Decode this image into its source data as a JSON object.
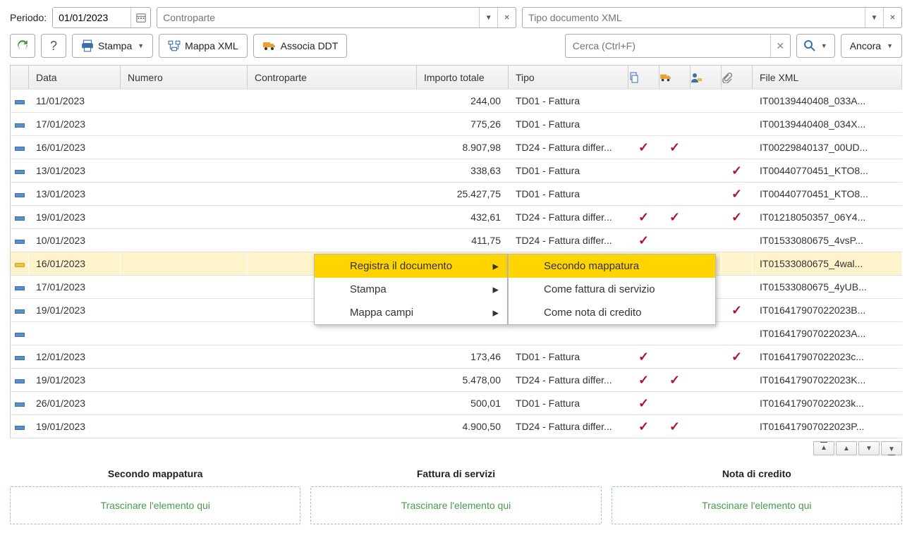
{
  "toolbar1": {
    "periodo_label": "Periodo:",
    "periodo_value": "01/01/2023",
    "controparte_placeholder": "Controparte",
    "tipodoc_placeholder": "Tipo documento XML"
  },
  "toolbar2": {
    "stampa_label": "Stampa",
    "mappa_label": "Mappa XML",
    "associa_label": "Associa DDT",
    "search_placeholder": "Cerca (Ctrl+F)",
    "ancora_label": "Ancora"
  },
  "columns": {
    "data": "Data",
    "numero": "Numero",
    "controparte": "Controparte",
    "importo": "Importo totale",
    "tipo": "Tipo",
    "file": "File XML"
  },
  "rows": [
    {
      "data": "11/01/2023",
      "numero": "",
      "contro": "",
      "importo": "244,00",
      "tipo": "TD01 - Fattura",
      "i1": false,
      "i2": false,
      "i3": false,
      "i4": false,
      "file": "IT00139440408_033A...",
      "sel": false
    },
    {
      "data": "17/01/2023",
      "numero": "",
      "contro": "",
      "importo": "775,26",
      "tipo": "TD01 - Fattura",
      "i1": false,
      "i2": false,
      "i3": false,
      "i4": false,
      "file": "IT00139440408_034X...",
      "sel": false
    },
    {
      "data": "16/01/2023",
      "numero": "",
      "contro": "",
      "importo": "8.907,98",
      "tipo": "TD24 - Fattura differ...",
      "i1": true,
      "i2": true,
      "i3": false,
      "i4": false,
      "file": "IT00229840137_00UD...",
      "sel": false
    },
    {
      "data": "13/01/2023",
      "numero": "",
      "contro": "",
      "importo": "338,63",
      "tipo": "TD01 - Fattura",
      "i1": false,
      "i2": false,
      "i3": false,
      "i4": true,
      "file": "IT00440770451_KTO8...",
      "sel": false
    },
    {
      "data": "13/01/2023",
      "numero": "",
      "contro": "",
      "importo": "25.427,75",
      "tipo": "TD01 - Fattura",
      "i1": false,
      "i2": false,
      "i3": false,
      "i4": true,
      "file": "IT00440770451_KTO8...",
      "sel": false
    },
    {
      "data": "19/01/2023",
      "numero": "",
      "contro": "",
      "importo": "432,61",
      "tipo": "TD24 - Fattura differ...",
      "i1": true,
      "i2": true,
      "i3": false,
      "i4": true,
      "file": "IT01218050357_06Y4...",
      "sel": false
    },
    {
      "data": "10/01/2023",
      "numero": "",
      "contro": "",
      "importo": "411,75",
      "tipo": "TD24 - Fattura differ...",
      "i1": true,
      "i2": false,
      "i3": false,
      "i4": false,
      "file": "IT01533080675_4vsP...",
      "sel": false
    },
    {
      "data": "16/01/2023",
      "numero": "",
      "contro": "",
      "importo": "",
      "tipo": "",
      "i1": false,
      "i2": false,
      "i3": false,
      "i4": false,
      "file": "IT01533080675_4wal...",
      "sel": true
    },
    {
      "data": "17/01/2023",
      "numero": "",
      "contro": "",
      "importo": "",
      "tipo": "",
      "i1": false,
      "i2": false,
      "i3": false,
      "i4": false,
      "file": "IT01533080675_4yUB...",
      "sel": false
    },
    {
      "data": "19/01/2023",
      "numero": "",
      "contro": "",
      "importo": "",
      "tipo": "",
      "i1": false,
      "i2": false,
      "i3": false,
      "i4": true,
      "file": "IT016417907022023B...",
      "sel": false
    },
    {
      "data": "",
      "numero": "",
      "contro": "",
      "importo": "",
      "tipo": "",
      "i1": false,
      "i2": false,
      "i3": false,
      "i4": false,
      "file": "IT016417907022023A...",
      "sel": false,
      "partial": true
    },
    {
      "data": "12/01/2023",
      "numero": "",
      "contro": "",
      "importo": "173,46",
      "tipo": "TD01 - Fattura",
      "i1": true,
      "i2": false,
      "i3": false,
      "i4": true,
      "file": "IT016417907022023c...",
      "sel": false
    },
    {
      "data": "19/01/2023",
      "numero": "",
      "contro": "",
      "importo": "5.478,00",
      "tipo": "TD24 - Fattura differ...",
      "i1": true,
      "i2": true,
      "i3": false,
      "i4": false,
      "file": "IT016417907022023K...",
      "sel": false
    },
    {
      "data": "26/01/2023",
      "numero": "",
      "contro": "",
      "importo": "500,01",
      "tipo": "TD01 - Fattura",
      "i1": true,
      "i2": false,
      "i3": false,
      "i4": false,
      "file": "IT016417907022023k...",
      "sel": false
    },
    {
      "data": "19/01/2023",
      "numero": "",
      "contro": "",
      "importo": "4.900,50",
      "tipo": "TD24 - Fattura differ...",
      "i1": true,
      "i2": true,
      "i3": false,
      "i4": false,
      "file": "IT016417907022023P...",
      "sel": false
    }
  ],
  "context_menu": {
    "registra": "Registra il documento",
    "stampa": "Stampa",
    "mappa": "Mappa campi",
    "sub_secondo": "Secondo mappatura",
    "sub_fattura": "Come fattura di servizio",
    "sub_nota": "Come nota di credito"
  },
  "dropzones": {
    "secondo_title": "Secondo mappatura",
    "fattura_title": "Fattura di servizi",
    "nota_title": "Nota di credito",
    "hint": "Trascinare l'elemento qui"
  }
}
